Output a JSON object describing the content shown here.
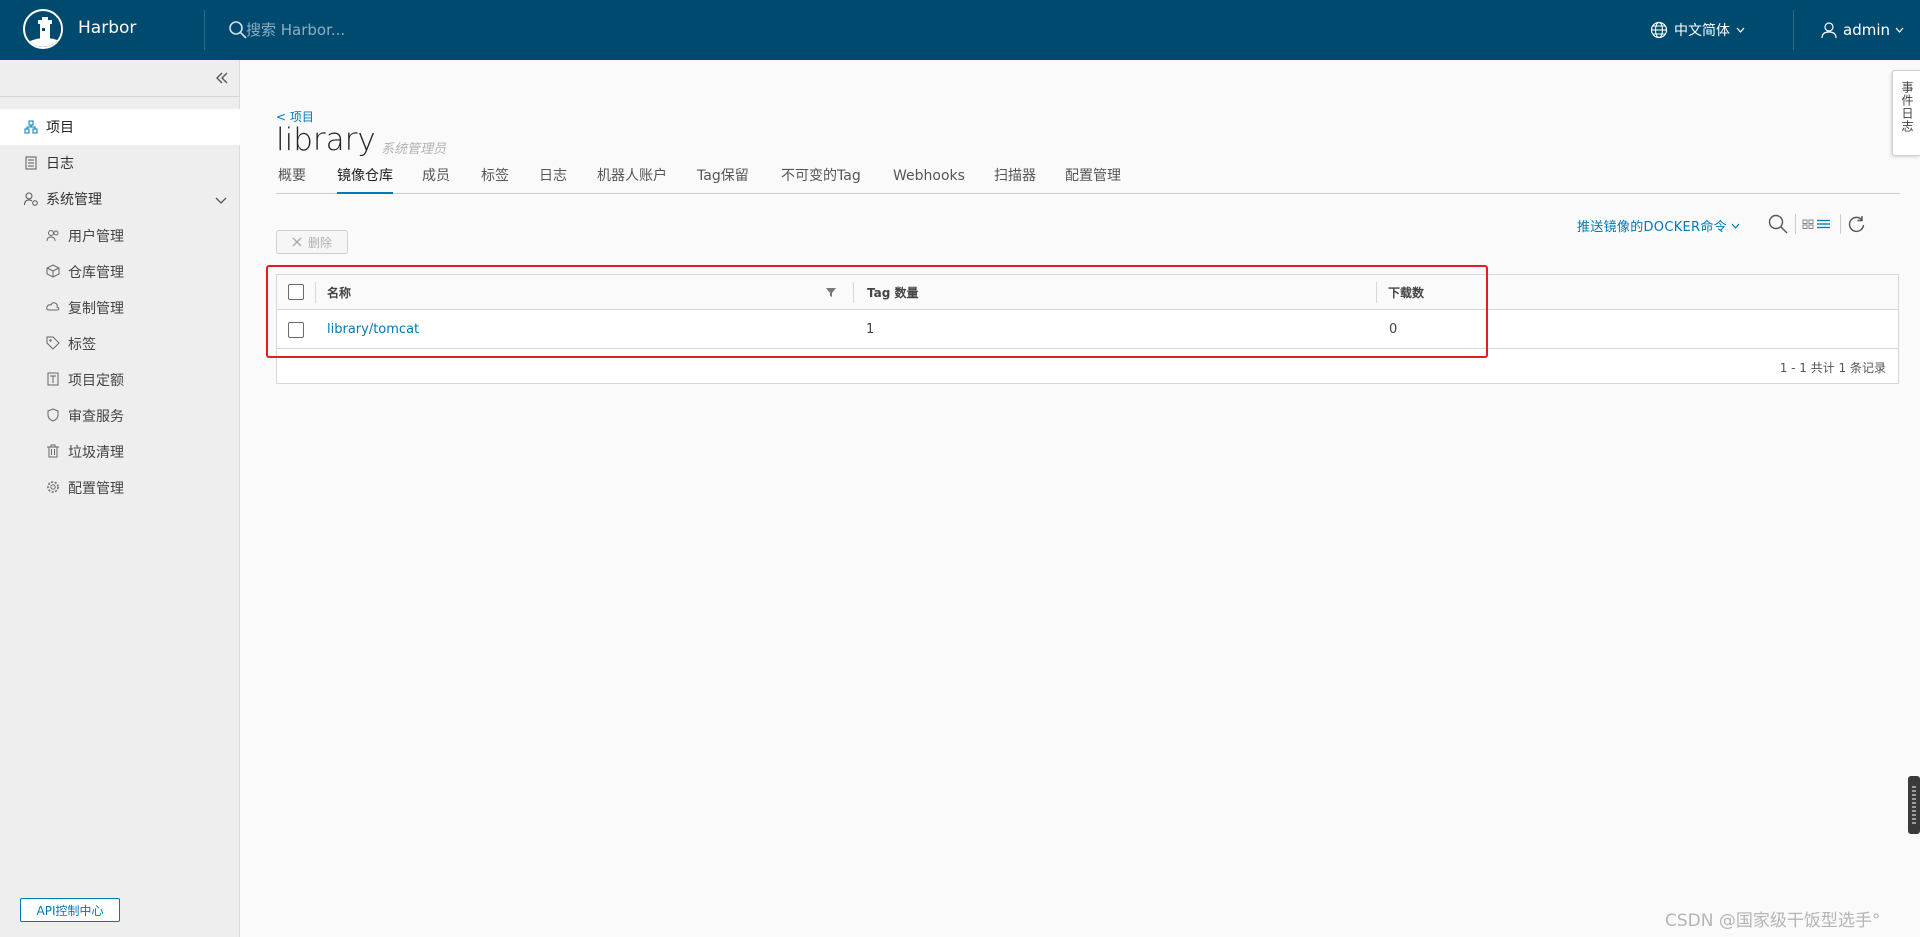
{
  "header": {
    "app_name": "Harbor",
    "search_placeholder": "搜索 Harbor...",
    "language": "中文简体",
    "user": "admin"
  },
  "sidebar": {
    "items": [
      {
        "label": "项目",
        "icon": "projects-icon",
        "active": true
      },
      {
        "label": "日志",
        "icon": "logs-icon",
        "active": false
      },
      {
        "label": "系统管理",
        "icon": "system-admin-icon",
        "active": false
      }
    ],
    "sub_items": [
      {
        "label": "用户管理",
        "icon": "users-icon"
      },
      {
        "label": "仓库管理",
        "icon": "registries-icon"
      },
      {
        "label": "复制管理",
        "icon": "replication-icon"
      },
      {
        "label": "标签",
        "icon": "tag-icon"
      },
      {
        "label": "项目定额",
        "icon": "quota-icon"
      },
      {
        "label": "审查服务",
        "icon": "shield-icon"
      },
      {
        "label": "垃圾清理",
        "icon": "trash-icon"
      },
      {
        "label": "配置管理",
        "icon": "gear-icon"
      }
    ],
    "api_button": "API控制中心"
  },
  "page": {
    "breadcrumb": "< 项目",
    "title": "library",
    "role": "系统管理员",
    "tabs": [
      "概要",
      "镜像仓库",
      "成员",
      "标签",
      "日志",
      "机器人账户",
      "Tag保留",
      "不可变的Tag",
      "Webhooks",
      "扫描器",
      "配置管理"
    ],
    "active_tab": "镜像仓库"
  },
  "toolbar": {
    "delete_label": "删除",
    "push_command": "推送镜像的DOCKER命令"
  },
  "table": {
    "columns": [
      "名称",
      "Tag 数量",
      "下载数"
    ],
    "rows": [
      {
        "name": "library/tomcat",
        "tag_count": "1",
        "downloads": "0"
      }
    ],
    "footer": "1 - 1 共计 1 条记录"
  },
  "side_panel": "事件日志",
  "watermark": "CSDN @国家级干饭型选手°",
  "colors": {
    "header_bg": "#004a70",
    "accent": "#0079b8",
    "highlight": "#e02020"
  }
}
